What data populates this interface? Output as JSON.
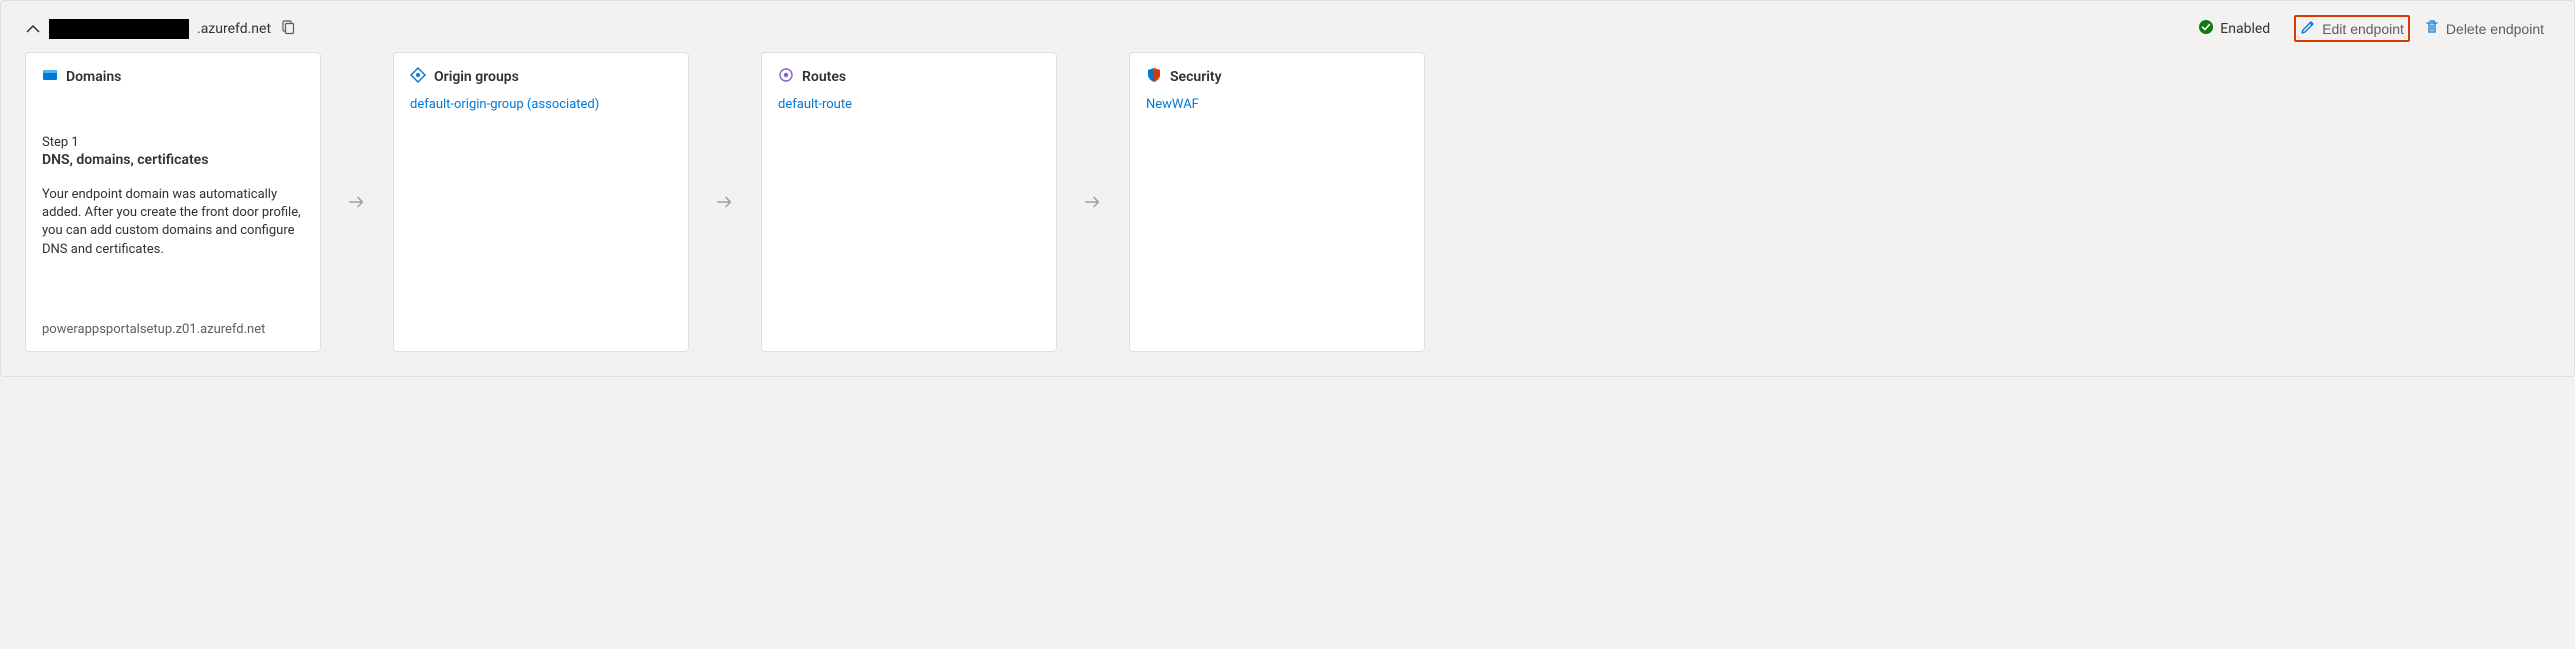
{
  "header": {
    "hostname_suffix": ".azurefd.net",
    "status_label": "Enabled",
    "edit_label": "Edit endpoint",
    "delete_label": "Delete endpoint"
  },
  "cards": {
    "domains": {
      "title": "Domains",
      "step_label": "Step 1",
      "step_title": "DNS, domains, certificates",
      "description": "Your endpoint domain was automatically added. After you create the front door profile, you can add custom domains and configure DNS and certificates.",
      "footer": "powerappsportalsetup.z01.azurefd.net"
    },
    "origin_groups": {
      "title": "Origin groups",
      "link": "default-origin-group (associated)"
    },
    "routes": {
      "title": "Routes",
      "link": "default-route"
    },
    "security": {
      "title": "Security",
      "link": "NewWAF"
    }
  }
}
